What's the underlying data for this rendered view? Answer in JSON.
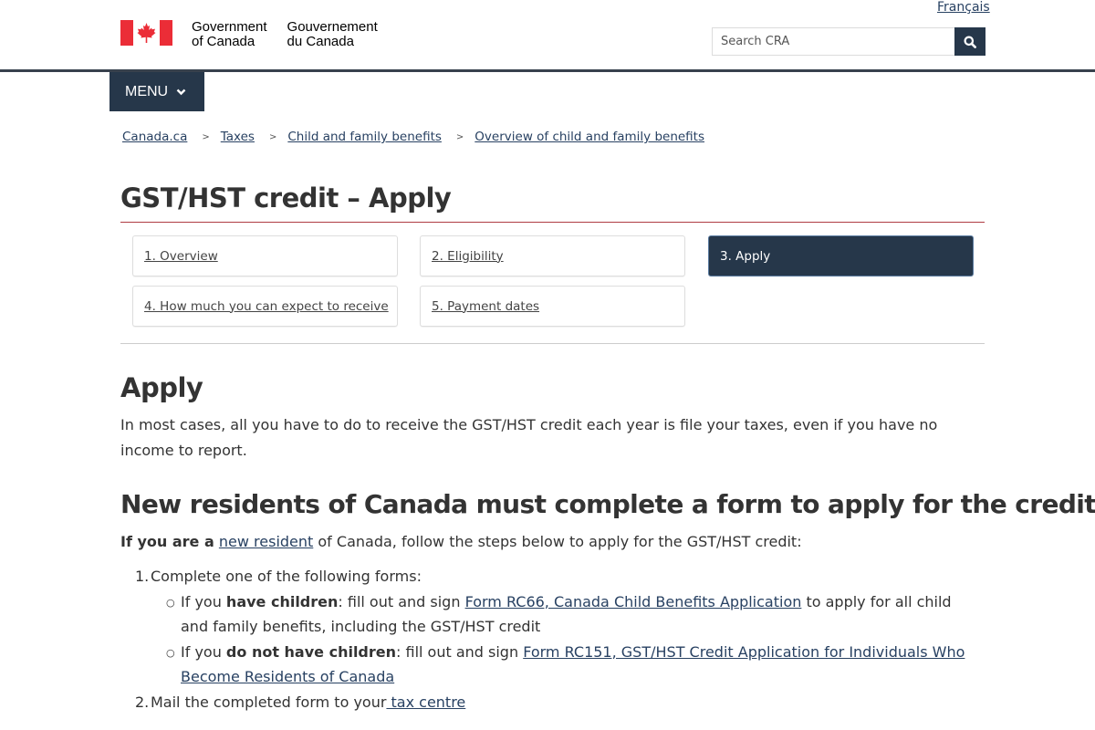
{
  "header": {
    "language_link": "Français",
    "brand_en_line1": "Government",
    "brand_en_line2": "of Canada",
    "brand_fr_line1": "Gouvernement",
    "brand_fr_line2": "du Canada",
    "search_placeholder": "Search CRA",
    "search_icon": "magnifier-icon",
    "menu_label": "MENU",
    "colors": {
      "primary": "#26374a",
      "flag_red": "#eb2d37",
      "title_rule": "#af3c43",
      "link": "#284162"
    }
  },
  "breadcrumb": [
    {
      "label": "Canada.ca"
    },
    {
      "label": "Taxes"
    },
    {
      "label": "Child and family benefits"
    },
    {
      "label": "Overview of child and family benefits"
    }
  ],
  "breadcrumb_separator": ">",
  "page_title": "GST/HST credit – Apply",
  "steps": [
    {
      "label": "1. Overview",
      "active": false
    },
    {
      "label": "2. Eligibility",
      "active": false
    },
    {
      "label": "3. Apply",
      "active": true
    },
    {
      "label": "4. How much you can expect to receive",
      "active": false
    },
    {
      "label": "5. Payment dates",
      "active": false
    }
  ],
  "apply": {
    "heading": "Apply",
    "intro": "In most cases, all you have to do to receive the GST/HST credit each year is file your taxes, even if you have no income to report."
  },
  "new_residents": {
    "heading": "New residents of Canada must complete a form to apply for the credit",
    "lead_bold": "If you are a",
    "lead_link": "new resident",
    "lead_rest": " of Canada, follow the steps below to apply for the GST/HST credit:",
    "step1_num": "1.",
    "step1_text": "Complete one of the following forms:",
    "sub1_pre": "If you ",
    "sub1_bold": "have children",
    "sub1_mid": ": fill out and sign ",
    "sub1_link": "Form RC66, Canada Child Benefits Application",
    "sub1_post": " to apply for all child and family benefits, including the GST/HST credit",
    "sub2_pre": "If you ",
    "sub2_bold": "do not have children",
    "sub2_mid": ": fill out and sign ",
    "sub2_link": "Form RC151, GST/HST Credit Application for Individuals Who Become Residents of Canada",
    "step2_num": "2.",
    "step2_text": "Mail the completed form to your",
    "step2_link": " tax centre",
    "bullet": "○"
  }
}
